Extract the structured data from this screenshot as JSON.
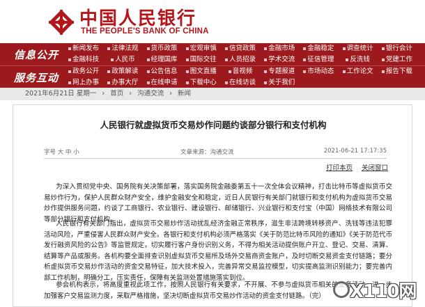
{
  "header": {
    "bank_name_cn": "中国人民银行",
    "bank_name_en": "THE PEOPLE'S BANK OF CHINA",
    "brand_color": "#b3171c"
  },
  "nav": {
    "background": "#9c1a1d",
    "sections": [
      {
        "heading": "信息公开",
        "links": [
          "新闻发布",
          "法律法规",
          "货币政策",
          "宏观审慎",
          "信贷政策",
          "金融市场",
          "金融稳定",
          "调查统计",
          "银行会计",
          "支付体系",
          "金融科技",
          "人民币",
          "经理国库",
          "国际交往",
          "人员招录",
          "学术交流",
          "征信管理",
          "反洗钱",
          "党建工作",
          "工会工作"
        ]
      },
      {
        "heading": "服务互动",
        "links": [
          "政务公开",
          "政策解读",
          "公告信息",
          "图文直播",
          "音视频",
          "专题报道",
          "市场动态",
          "工作论文",
          "报告下载",
          "服务指南",
          "网上办事",
          "办事大厅",
          "在线申请",
          "下载中心",
          "在线访谈",
          "关于我们"
        ]
      }
    ]
  },
  "breadcrumb": {
    "date": "2021年6月21日 星期一",
    "items": [
      "首页",
      "沟通交流",
      "新闻"
    ],
    "separator": "›"
  },
  "article": {
    "title": "人民银行就虚拟货币交易炒作问题约谈部分银行和支付机构",
    "meta_left": "字号 大 中 小",
    "meta_mid": "文章来源：沟通交流",
    "meta_right": "2021-06-21 17:17:35",
    "actions": [
      "打印本页",
      "关闭窗口"
    ],
    "paragraphs": [
      "为深入贯彻党中央、国务院有关决策部署，落实国务院金融委第五十一次全体会议精神，打击比特币等虚拟货币交易炒作行为，保护人民群众财产安全，维护金融安全和稳定，近日人民银行有关部门就银行和支付机构为虚拟货币交易炒作提供服务问题，约谈了工商银行、农业银行、建设银行、邮储银行、兴业银行和支付宝（中国）网络技术有限公司等部分银行和支付机构。",
      "人民银行有关部门指出，虚拟货币交易炒作活动扰乱经济金融正常秩序，滋生非法跨境转移资产、洗钱等违法犯罪活动风险，严重侵害人民群众财产安全。各银行和支付机构必须严格落实《关于防范比特币风险的通知》《关于防范代币发行融资风险的公告》等监管规定，切实履行客户身份识别义务，不得为相关活动提供账户开立、登记、交易、清算、结算等产品或服务。各机构要全面排查识别虚拟货币交易所及场外交易商资金账户，及时切断交易资金支付链路；要分析虚拟货币交易炒作活动的资金交易特征，加大技术投入，完善异常交易监控模型，切实提高监测识别能力；要完善内部工作机制，明确分工，压实责任，保障有关监测处置措施落实到位。",
      "参会机构表示，将高度重视此项工作，按照人民银行有关要求，不开展、不参与虚拟货币相关的业务活动，进一步加强客户交易监测力度，采取严格措施，坚决切断虚拟货币交易炒作活动的资金支付链路。（完）"
    ]
  },
  "watermark": {
    "text": "X110网"
  }
}
